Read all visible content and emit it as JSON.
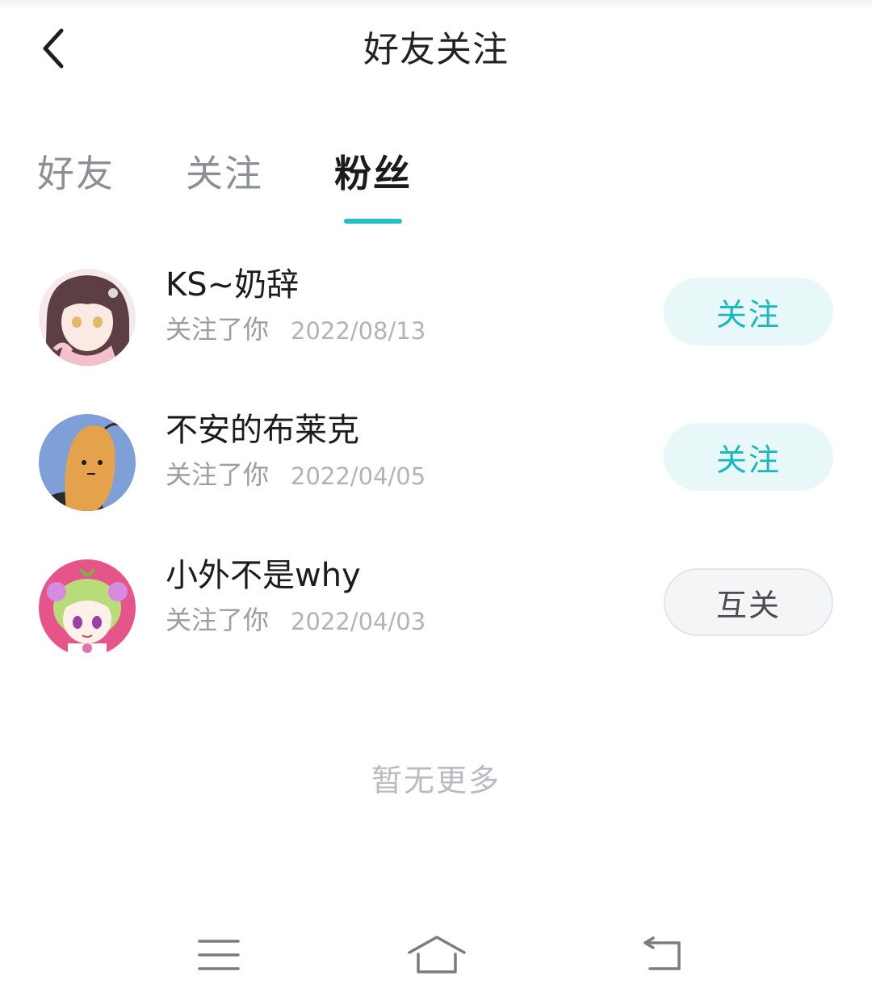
{
  "header": {
    "title": "好友关注",
    "back_icon": "chevron-left-icon"
  },
  "tabs": [
    {
      "label": "好友",
      "active": false
    },
    {
      "label": "关注",
      "active": false
    },
    {
      "label": "粉丝",
      "active": true
    }
  ],
  "accent_color": "#1fc1c9",
  "fans": [
    {
      "name": "KS~奶辞",
      "status": "关注了你",
      "date": "2022/08/13",
      "action": "关注",
      "action_type": "follow",
      "avatar": "anime-girl-avatar"
    },
    {
      "name": "不安的布莱克",
      "status": "关注了你",
      "date": "2022/04/05",
      "action": "关注",
      "action_type": "follow",
      "avatar": "bean-character-avatar"
    },
    {
      "name": "小外不是why",
      "status": "关注了你",
      "date": "2022/04/03",
      "action": "互关",
      "action_type": "mutual",
      "avatar": "green-hair-girl-avatar"
    }
  ],
  "footer_text": "暂无更多",
  "navbar": {
    "menu_icon": "menu-icon",
    "home_icon": "home-icon",
    "back_icon": "back-arrow-icon"
  }
}
